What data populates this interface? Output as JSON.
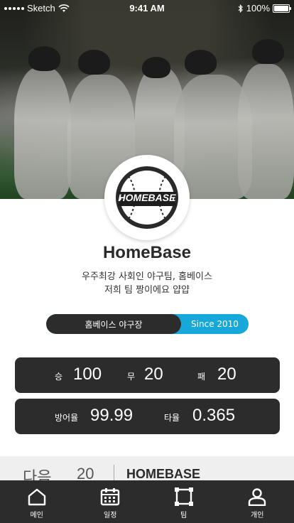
{
  "status_bar": {
    "carrier": "Sketch",
    "time": "9:41 AM",
    "battery": "100%"
  },
  "team": {
    "logo_text": "HOMEBASE",
    "name": "HomeBase",
    "description_line1": "우주최강 사회인 야구팀, 홈베이스",
    "description_line2": "저희 팀 짱이에요 얍얍"
  },
  "info_pill": {
    "stadium": "홈베이스 야구장",
    "since": "Since 2010",
    "accent_color": "#16a8d8"
  },
  "record": {
    "win_label": "승",
    "win_value": "100",
    "draw_label": "무",
    "draw_value": "20",
    "loss_label": "패",
    "loss_value": "20"
  },
  "rates": {
    "era_label": "방어율",
    "era_value": "99.99",
    "avg_label": "타율",
    "avg_value": "0.365"
  },
  "next_game": {
    "label": "다음",
    "number": "20",
    "opponent": "HOMEBASE"
  },
  "tab_bar": {
    "items": [
      {
        "label": "메인",
        "icon": "home-icon"
      },
      {
        "label": "일정",
        "icon": "calendar-icon"
      },
      {
        "label": "팀",
        "icon": "team-icon"
      },
      {
        "label": "개인",
        "icon": "person-icon"
      }
    ]
  }
}
